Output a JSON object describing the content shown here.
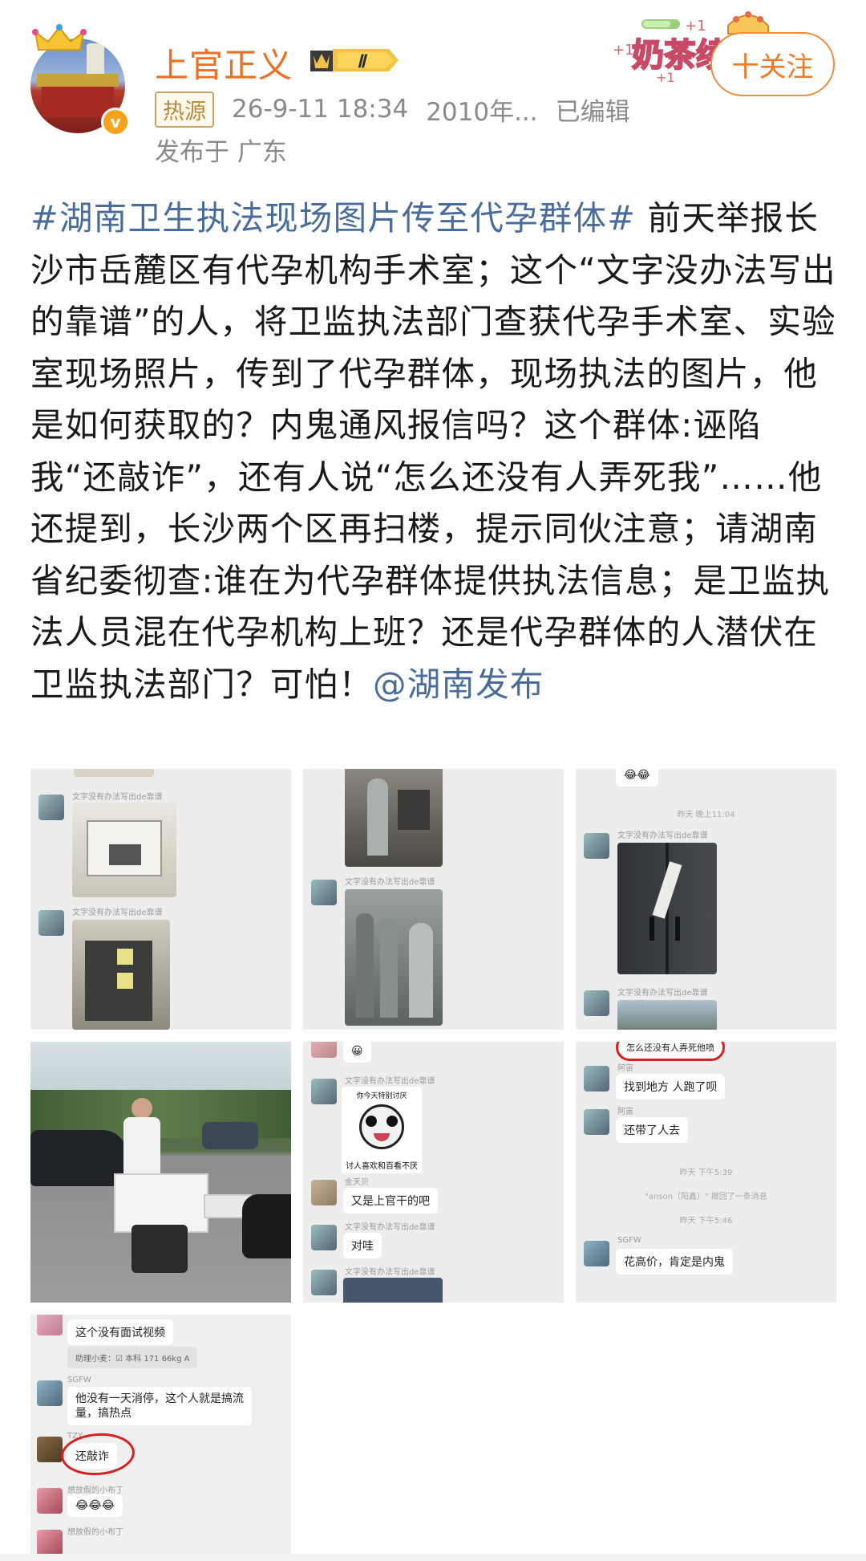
{
  "header": {
    "username": "上官正义",
    "level": "Ⅱ",
    "hot_tag": "热源",
    "timestamp": "26-9-11 18:34",
    "source": "2010年...",
    "edited": "已编辑",
    "location": "发布于 广东",
    "follow_label": "十关注",
    "verified_mark": "v",
    "deco_text": "奶茶续",
    "plus_one": "+1"
  },
  "post": {
    "hashtag": "#湖南卫生执法现场图片传至代孕群体#",
    "body": " 前天举报长沙市岳麓区有代孕机构手术室；这个“文字没办法写出的靠谱”的人，将卫监执法部门查获代孕手术室、实验室现场照片，传到了代孕群体，现场执法的图片，他是如何获取的？内鬼通风报信吗？这个群体:诬陷我“还敲诈”，还有人说“怎么还没有人弄死我”……他还提到，长沙两个区再扫楼，提示同伙注意；请湖南省纪委彻查:谁在为代孕群体提供执法信息；是卫监执法人员混在代孕机构上班？还是代孕群体的人潜伏在卫监执法部门？可怕！",
    "mention": "@湖南发布"
  },
  "images": {
    "img1": {
      "sender": "文字没有办法写出de靠谱"
    },
    "img2": {
      "sender": "文字没有办法写出de靠谱"
    },
    "img3": {
      "time": "昨天 晚上11:04",
      "sender": "文字没有办法写出de靠谱"
    },
    "img5": {
      "sender": "文字没有办法写出de靠谱",
      "meme_top": "你今天特别讨厌",
      "meme_bottom": "讨人喜欢和百看不厌",
      "user2": "金天贝",
      "msg1": "又是上官干的吧",
      "msg2": "对哇"
    },
    "img6": {
      "top_msg": "怎么还没有人弄死他喷",
      "user": "阿宙",
      "msg1": "找到地方 人跑了呗",
      "msg2": "还带了人去",
      "time1": "昨天 下午5:39",
      "recall": "\"anson（阳鑫）\" 撤回了一条消息",
      "time2": "昨天 下午5:46",
      "user2": "SGFW",
      "msg3": "花高价，肯定是内鬼"
    },
    "img7": {
      "msg1": "这个没有面试视频",
      "sub1": "助理小麦：☑ 本科 171 66kg A",
      "user1": "SGFW",
      "msg2a": "他没有一天消停，这个人就是搞流",
      "msg2b": "量，搞热点",
      "user2": "TZY",
      "msg3": "还敲诈",
      "user3": "想放假的小布丁",
      "msg4": "😂😂😂",
      "user4": "想放假的小布丁"
    }
  },
  "colors": {
    "accent_orange": "#f16d1f",
    "link_blue": "#4a6c9b",
    "meta_gray": "#8a8a8a"
  }
}
